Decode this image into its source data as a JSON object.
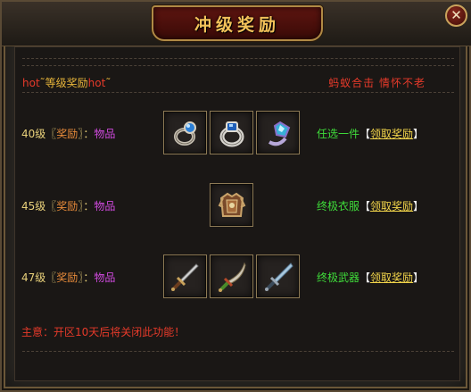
{
  "window": {
    "title": "冲级奖励",
    "close_glyph": "✕"
  },
  "header": {
    "left_prefix": "hot",
    "left_main": "等级奖励",
    "left_suffix": "hot",
    "right_text": "蚂蚁合击 情怀不老"
  },
  "rewards": [
    {
      "level": "40级",
      "bracket_open": "〖",
      "reward_word": "奖励",
      "bracket_close": "〗",
      "colon": "：",
      "goods": "物品",
      "items": [
        "ring-blue-icon",
        "ring-silver-icon",
        "ring-gem-icon"
      ],
      "note": "任选一件",
      "claim_open": "【",
      "claim_label": "领取奖励",
      "claim_close": "】"
    },
    {
      "level": "45级",
      "bracket_open": "〖",
      "reward_word": "奖励",
      "bracket_close": "〗",
      "colon": "：",
      "goods": "物品",
      "items": [
        "armor-icon"
      ],
      "note": "终极衣服",
      "claim_open": "【",
      "claim_label": "领取奖励",
      "claim_close": "】"
    },
    {
      "level": "47级",
      "bracket_open": "〖",
      "reward_word": "奖励",
      "bracket_close": "〗",
      "colon": "：",
      "goods": "物品",
      "items": [
        "sword-icon",
        "saber-icon",
        "blade-icon"
      ],
      "note": "终极武器",
      "claim_open": "【",
      "claim_label": "领取奖励",
      "claim_close": "】"
    }
  ],
  "notice": "主意：开区10天后将关闭此功能！"
}
